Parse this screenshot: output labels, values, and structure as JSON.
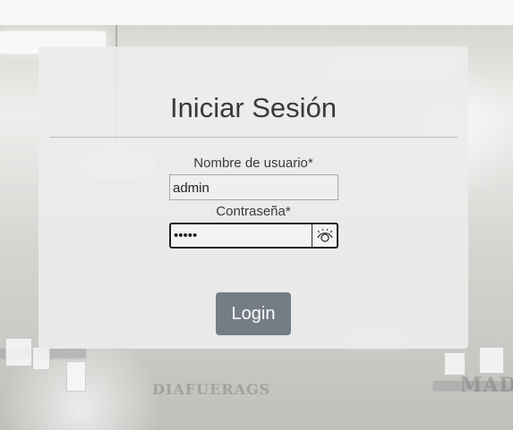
{
  "login": {
    "title": "Iniciar Sesión",
    "username_label": "Nombre de usuario*",
    "username_value": "admin",
    "password_label": "Contraseña*",
    "password_value": "•••••",
    "show_password_icon": "eye-icon",
    "login_button": "Login"
  },
  "background": {
    "sign_text_1": "DIAFUERAGS",
    "sign_text_2": "MAD"
  },
  "colors": {
    "card_background": "#ececec",
    "title_text": "#3a3a3a",
    "button_background": "#747c85",
    "focused_border": "#1f1f1f"
  }
}
